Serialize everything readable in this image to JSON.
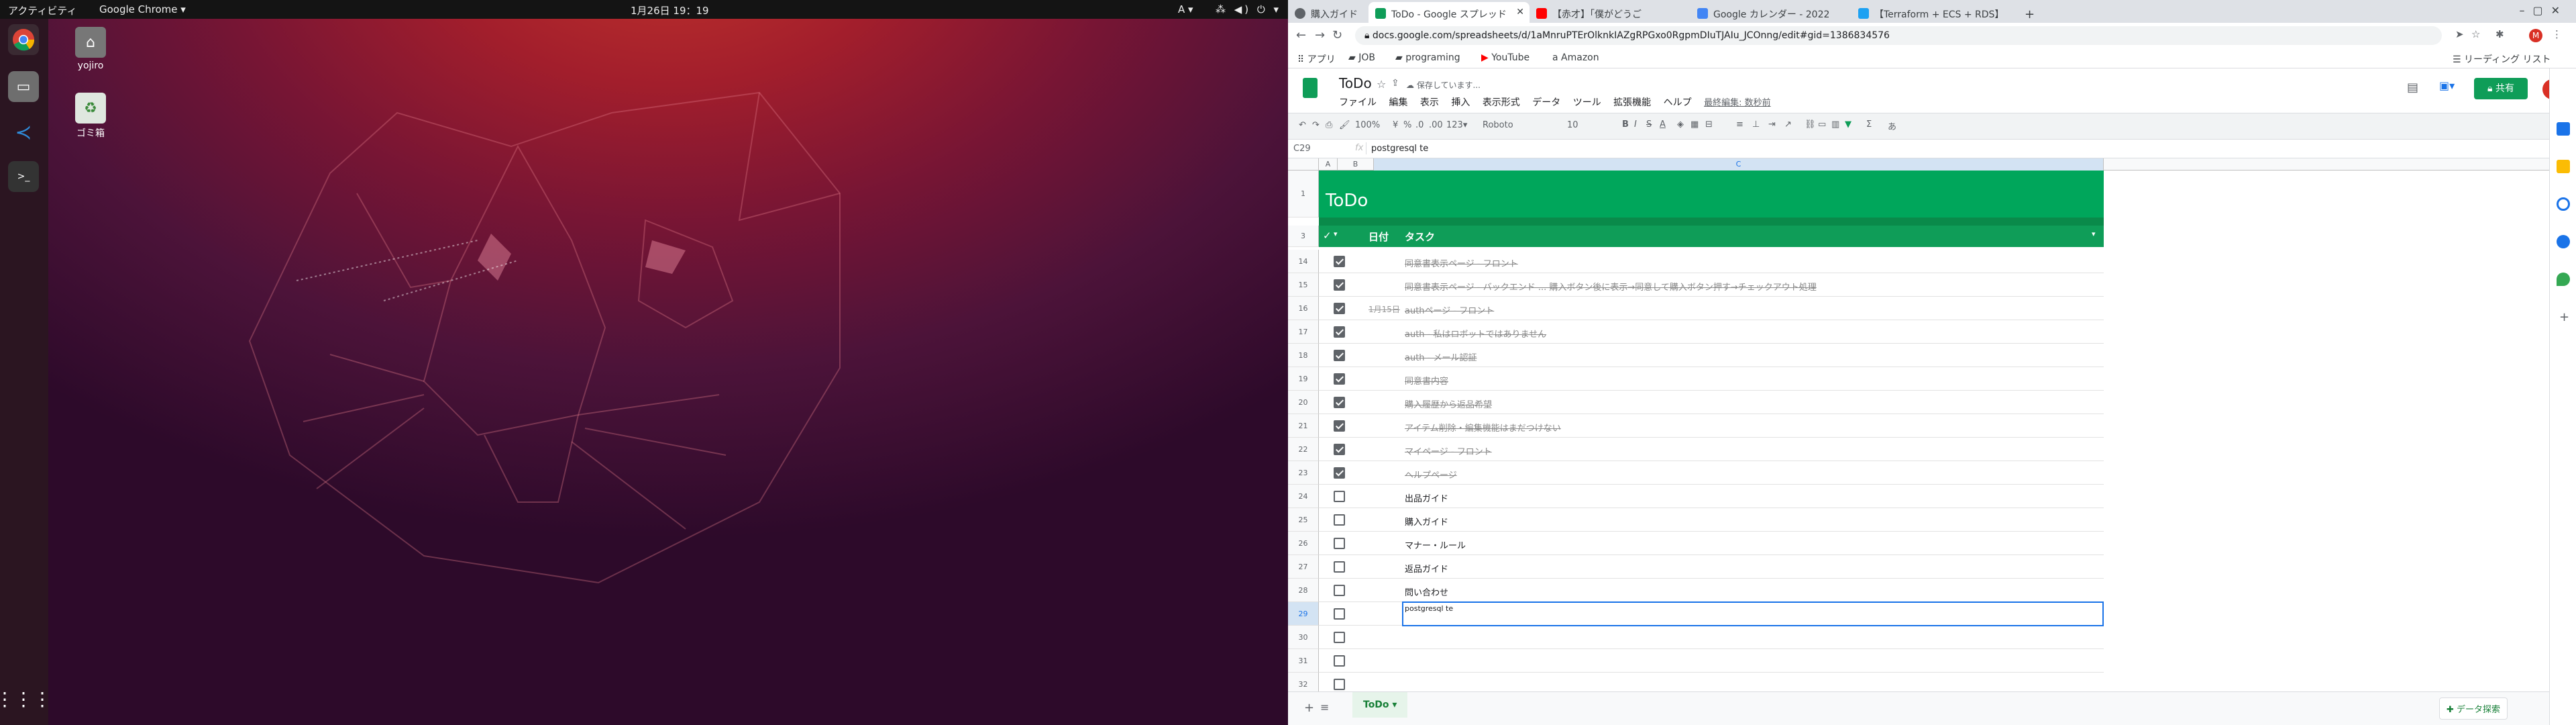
{
  "ubuntu": {
    "activities": "アクティビティ",
    "app_menu": "Google Chrome ▾",
    "clock": "1月26日 19：19",
    "ime": "A ▾",
    "system_icons": "⁂ ◀) ⏻ ▾"
  },
  "desktop": {
    "icons": [
      {
        "label": "yojiro",
        "icon": "home-folder-icon"
      },
      {
        "label": "ゴミ箱",
        "icon": "trash-icon"
      }
    ]
  },
  "dock": [
    "chrome-icon",
    "files-icon",
    "vscode-icon",
    "terminal-icon",
    "apps-grid-icon"
  ],
  "chrome": {
    "tabs": [
      {
        "title": "購入ガイド",
        "color": "#5f6368",
        "active": false
      },
      {
        "title": "ToDo - Google スプレッド",
        "color": "#0f9d58",
        "active": true
      },
      {
        "title": "【赤才】「僕がどうご",
        "color": "#ff0000",
        "active": false
      },
      {
        "title": "Google カレンダー - 2022",
        "color": "#4285f4",
        "active": false
      },
      {
        "title": "【Terraform + ECS + RDS】",
        "color": "#1da1f2",
        "active": false
      }
    ],
    "new_tab": "+",
    "url": "docs.google.com/spreadsheets/d/1aMnruPTErOlknkIAZgRPGxo0RgpmDIuTJAIu_JCOnng/edit#gid=1386834576",
    "bookmarks": [
      "アプリ",
      "JOB",
      "programing",
      "YouTube",
      "Amazon"
    ],
    "reading_list": "リーディング リスト"
  },
  "sheets": {
    "doc_title": "ToDo",
    "save_status": "保存しています...",
    "menus": [
      "ファイル",
      "編集",
      "表示",
      "挿入",
      "表示形式",
      "データ",
      "ツール",
      "拡張機能",
      "ヘルプ"
    ],
    "last_edit": "最終編集: 数秒前",
    "share": "共有",
    "avatar": "M",
    "toolbar": {
      "zoom": "100%",
      "currency": "¥",
      "percent": "%",
      "dec1": ".0",
      "dec2": ".00",
      "format": "123▾",
      "font": "Roboto",
      "size": "10"
    },
    "cell_ref": "C29",
    "fx": "fx",
    "formula": "postgresql te",
    "columns": [
      "A",
      "B",
      "C"
    ],
    "title_row_num": "1",
    "header_row_num": "3",
    "sheet_title": "ToDo",
    "header": {
      "check": "✓",
      "date": "日付",
      "task": "タスク"
    },
    "rows": [
      {
        "num": "14",
        "checked": true,
        "date": "",
        "task": "同意書表示ページ - フロント"
      },
      {
        "num": "15",
        "checked": true,
        "date": "",
        "task": "同意書表示ページ - バックエンド ... 購入ボタン後に表示→同意して購入ボタン押す→チェックアウト処理"
      },
      {
        "num": "16",
        "checked": true,
        "date": "1月15日",
        "task": "authページ - フロント"
      },
      {
        "num": "17",
        "checked": true,
        "date": "",
        "task": "auth - 私はロボットではありません"
      },
      {
        "num": "18",
        "checked": true,
        "date": "",
        "task": "auth - メール認証"
      },
      {
        "num": "19",
        "checked": true,
        "date": "",
        "task": "同意書内容"
      },
      {
        "num": "20",
        "checked": true,
        "date": "",
        "task": "購入履歴から返品希望"
      },
      {
        "num": "21",
        "checked": true,
        "date": "",
        "task": "アイテム削除・編集機能はまだつけない"
      },
      {
        "num": "22",
        "checked": true,
        "date": "",
        "task": "マイページ - フロント"
      },
      {
        "num": "23",
        "checked": true,
        "date": "",
        "task": "ヘルプページ"
      },
      {
        "num": "24",
        "checked": false,
        "date": "",
        "task": "出品ガイド"
      },
      {
        "num": "25",
        "checked": false,
        "date": "",
        "task": "購入ガイド"
      },
      {
        "num": "26",
        "checked": false,
        "date": "",
        "task": "マナー・ルール"
      },
      {
        "num": "27",
        "checked": false,
        "date": "",
        "task": "返品ガイド"
      },
      {
        "num": "28",
        "checked": false,
        "date": "",
        "task": "問い合わせ"
      },
      {
        "num": "29",
        "checked": false,
        "date": "",
        "task": "postgresql te"
      },
      {
        "num": "30",
        "checked": false,
        "date": "",
        "task": ""
      },
      {
        "num": "31",
        "checked": false,
        "date": "",
        "task": ""
      },
      {
        "num": "32",
        "checked": false,
        "date": "",
        "task": ""
      }
    ],
    "sheet_tab": "ToDo ▾",
    "explore": "データ探索"
  }
}
